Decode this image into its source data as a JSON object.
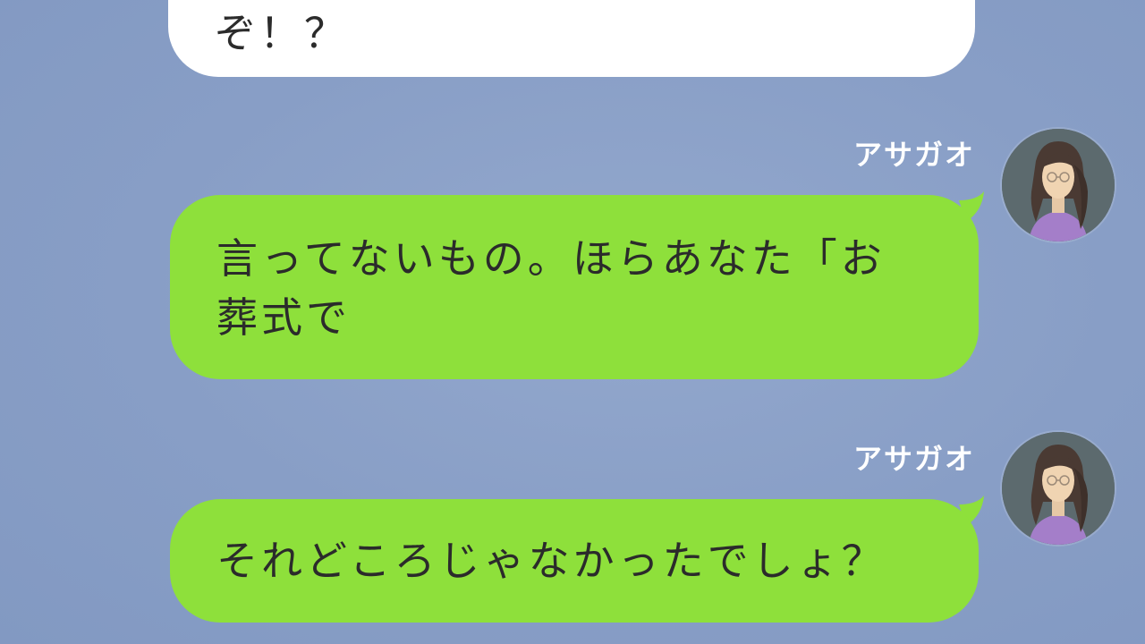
{
  "chat": {
    "messages": [
      {
        "side": "left",
        "bubble_color": "#ffffff",
        "text_lines": [
          "ぞ！？"
        ]
      },
      {
        "side": "right",
        "sender": "アサガオ",
        "bubble_color": "#8ee03b",
        "text_lines": [
          "言ってないもの。ほらあなた「お",
          "葬式で"
        ]
      },
      {
        "side": "right",
        "sender": "アサガオ",
        "bubble_color": "#8ee03b",
        "text_lines": [
          "それどころじゃなかったでしょ？"
        ]
      }
    ]
  },
  "avatar": {
    "icon": "woman-with-glasses-avatar-icon"
  },
  "colors": {
    "background": "#8aa0c8",
    "incoming_bubble": "#ffffff",
    "outgoing_bubble": "#8ee03b",
    "text": "#2b2b2b",
    "sender_name": "#ffffff"
  }
}
